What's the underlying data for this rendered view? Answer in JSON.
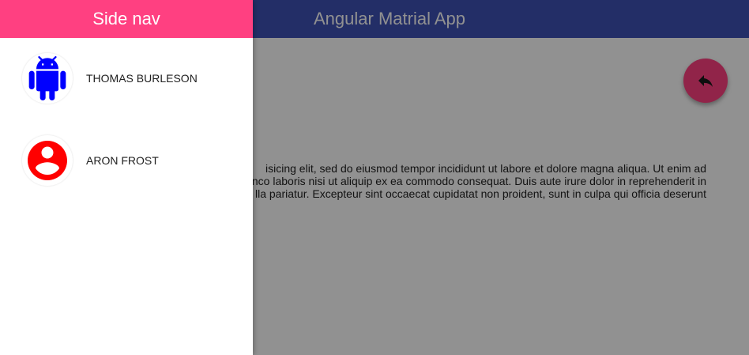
{
  "app": {
    "title": "Angular Matrial App"
  },
  "content": {
    "lines": [
      "isicing elit, sed do eiusmod tempor incididunt ut labore et dolore magna aliqua. Ut enim ad",
      "nco laboris nisi ut aliquip ex ea commodo consequat. Duis aute irure dolor in reprehenderit in",
      "lla pariatur. Excepteur sint occaecat cupidatat non proident, sunt in culpa qui officia deserunt"
    ]
  },
  "fab": {
    "icon": "reply-icon"
  },
  "sidenav": {
    "title": "Side nav",
    "items": [
      {
        "label": "THOMAS BURLESON",
        "icon": "android-icon",
        "icon_color": "#0000ff"
      },
      {
        "label": "ARON FROST",
        "icon": "account-circle-icon",
        "icon_color": "#ff0000"
      }
    ]
  },
  "colors": {
    "toolbar": "#3f51b5",
    "accent": "#ff4081",
    "backdrop": "rgba(0,0,0,0.43)"
  }
}
